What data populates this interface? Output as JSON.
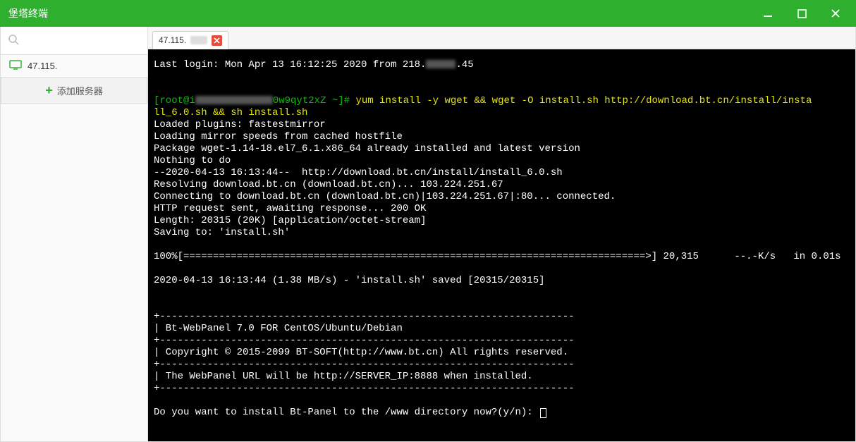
{
  "window": {
    "title": "堡塔终端"
  },
  "sidebar": {
    "search_placeholder": "",
    "server_ip_masked": "47.115.",
    "add_server_label": "添加服务器"
  },
  "tab": {
    "label_prefix": "47.115."
  },
  "terminal": {
    "last_login_pre": "Last login: Mon Apr 13 16:12:25 2020 from 218.",
    "last_login_post": ".45",
    "prompt_user": "[root@i",
    "prompt_host_suffix": "0w9qyt2xZ ~]# ",
    "cmd": "yum install -y wget && wget -O install.sh http://download.bt.cn/install/insta",
    "line2": "ll_6.0.sh && sh install.sh",
    "l3": "Loaded plugins: fastestmirror",
    "l4": "Loading mirror speeds from cached hostfile",
    "l5": "Package wget-1.14-18.el7_6.1.x86_64 already installed and latest version",
    "l6": "Nothing to do",
    "l7": "--2020-04-13 16:13:44--  http://download.bt.cn/install/install_6.0.sh",
    "l8": "Resolving download.bt.cn (download.bt.cn)... 103.224.251.67",
    "l9": "Connecting to download.bt.cn (download.bt.cn)|103.224.251.67|:80... connected.",
    "l10": "HTTP request sent, awaiting response... 200 OK",
    "l11": "Length: 20315 (20K) [application/octet-stream]",
    "l12": "Saving to: 'install.sh'",
    "progress": "100%[==============================================================================>] 20,315      --.-K/s   in 0.01s",
    "saved": "2020-04-13 16:13:44 (1.38 MB/s) - 'install.sh' saved [20315/20315]",
    "sep": "+----------------------------------------------------------------------",
    "panel1": "| Bt-WebPanel 7.0 FOR CentOS/Ubuntu/Debian",
    "panel2": "| Copyright © 2015-2099 BT-SOFT(http://www.bt.cn) All rights reserved.",
    "panel3": "| The WebPanel URL will be http://SERVER_IP:8888 when installed.",
    "prompt_q": "Do you want to install Bt-Panel to the /www directory now?(y/n): "
  }
}
